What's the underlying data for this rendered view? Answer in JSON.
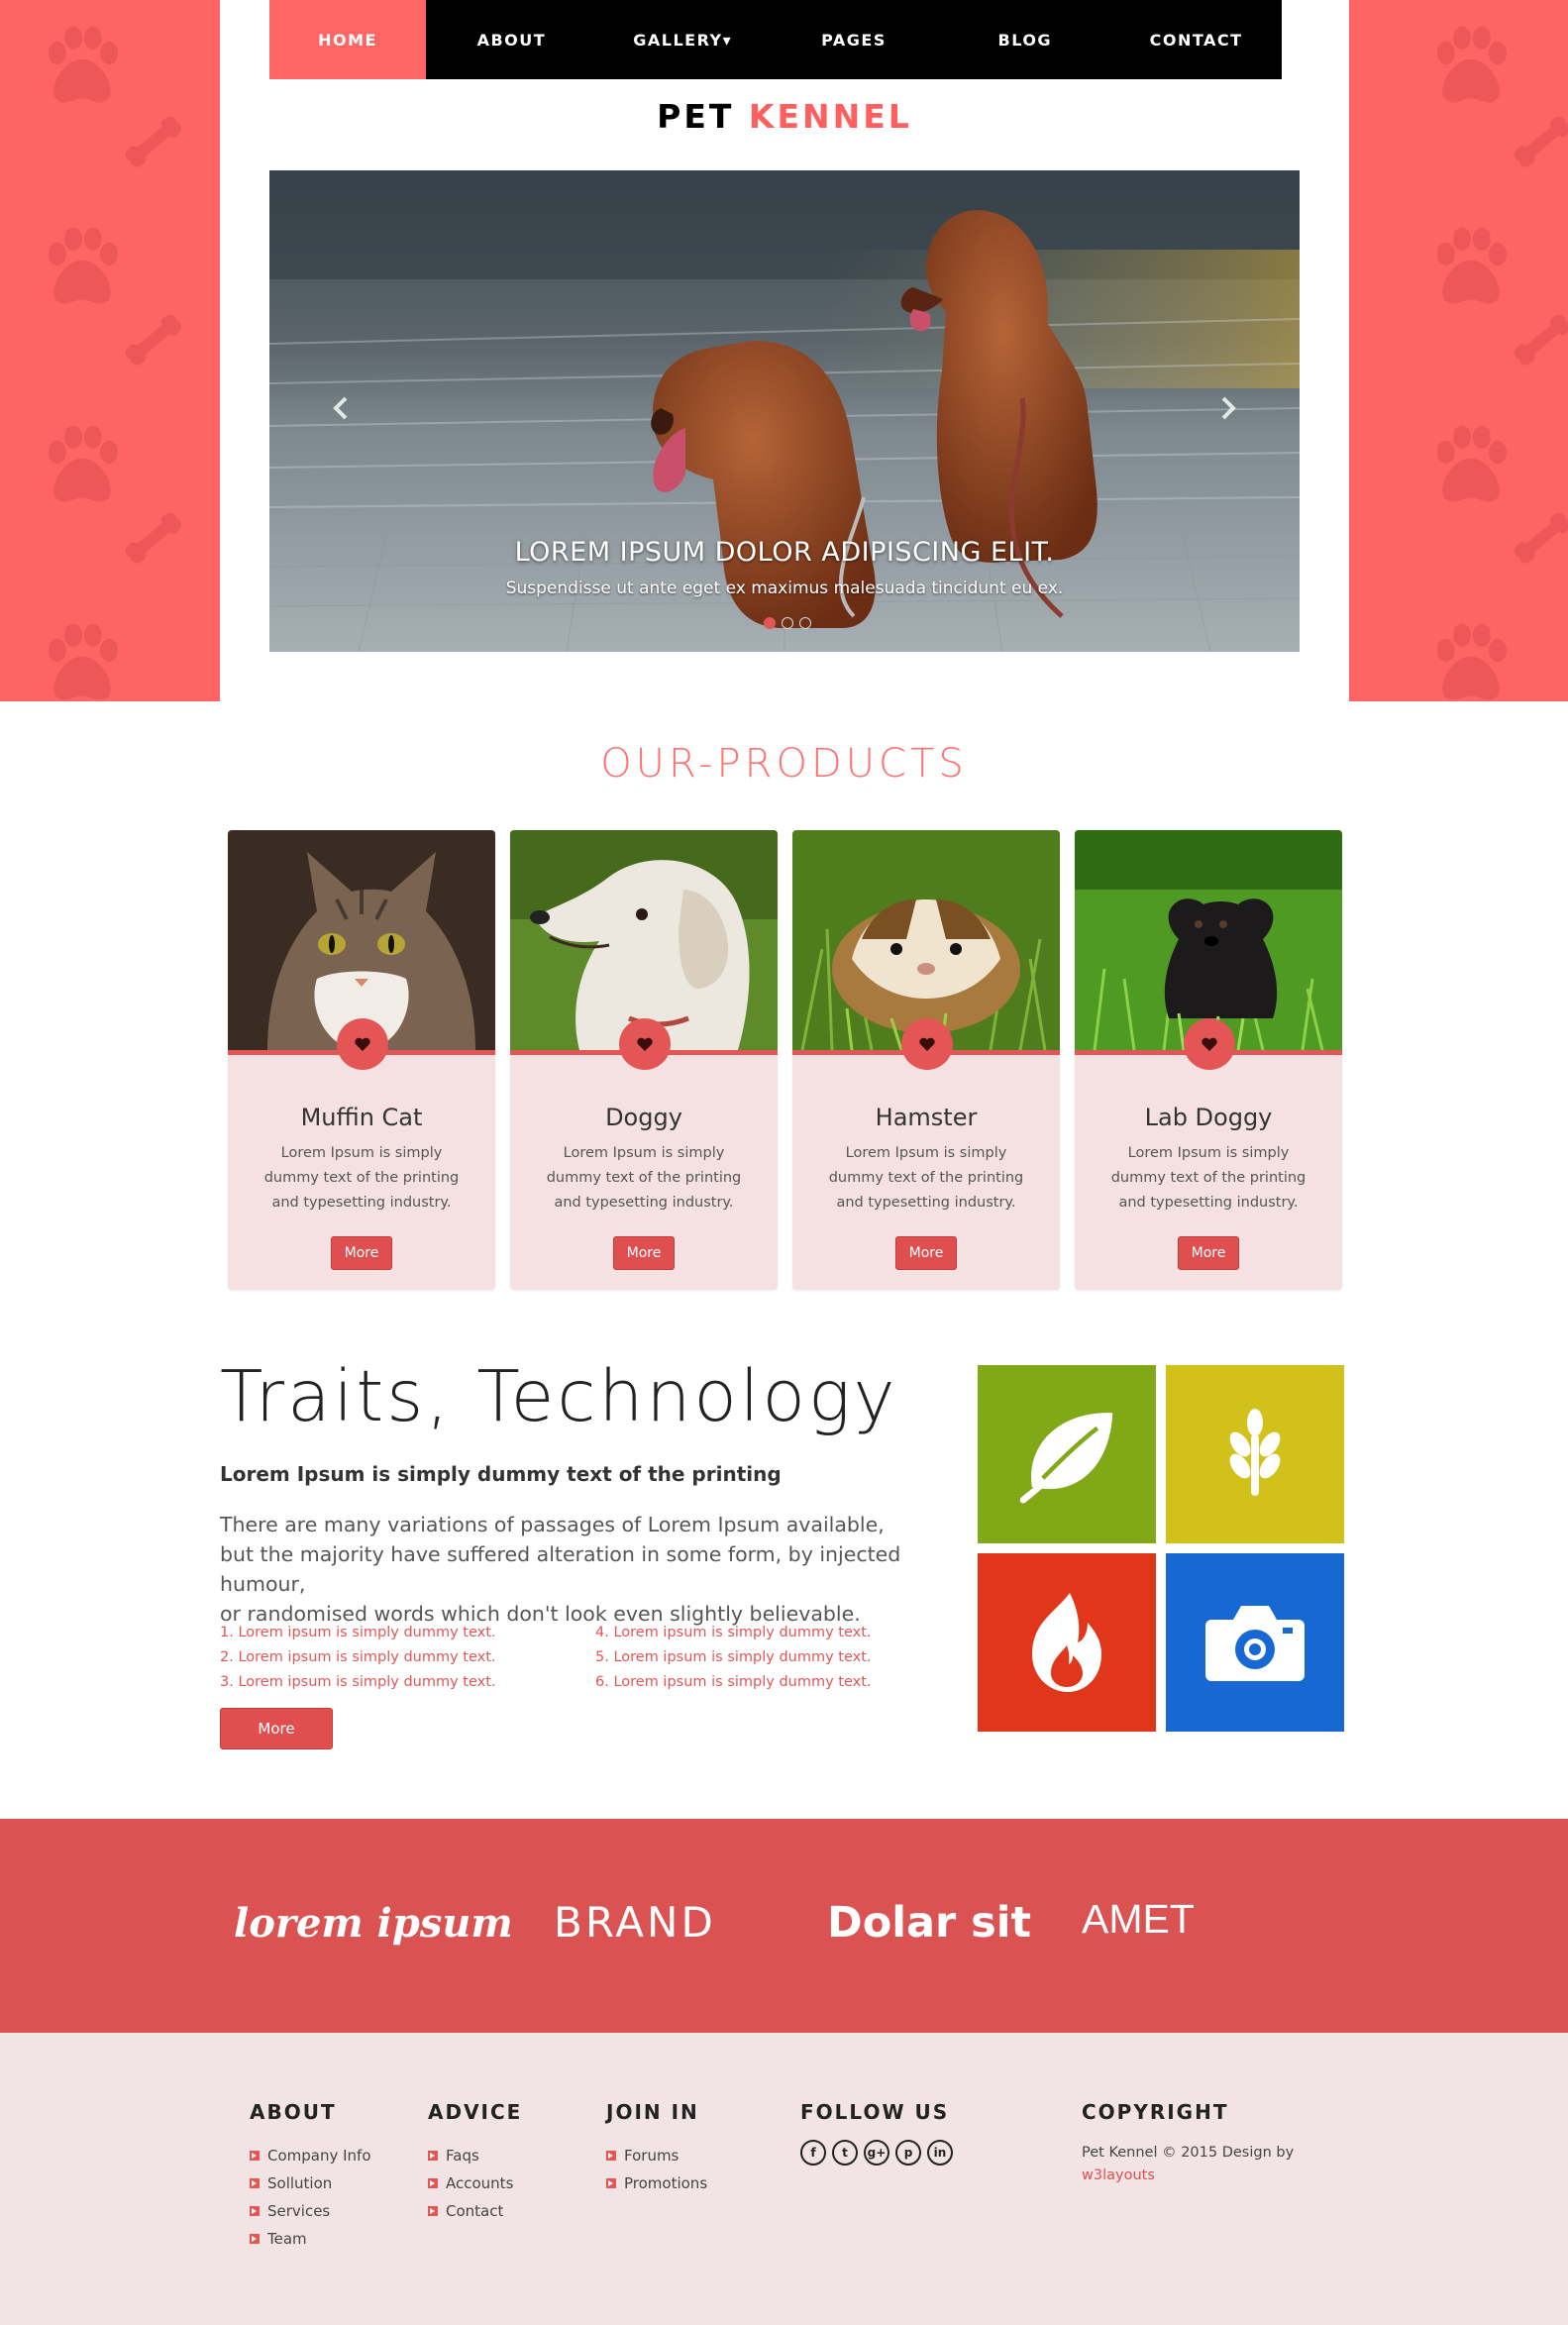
{
  "nav": {
    "items": [
      {
        "label": "HOME",
        "active": true
      },
      {
        "label": "ABOUT"
      },
      {
        "label": "GALLERY▾"
      },
      {
        "label": "PAGES"
      },
      {
        "label": "BLOG"
      },
      {
        "label": "CONTACT"
      }
    ]
  },
  "logo": {
    "part1": "PET",
    "part2": "KENNEL"
  },
  "slider": {
    "caption_title": "LOREM IPSUM DOLOR ADIPISCING ELIT.",
    "caption_text": "Suspendisse ut ante eget ex maximus malesuada tincidunt eu ex.",
    "slides": 3,
    "active_slide": 1
  },
  "products": {
    "title": "OUR-PRODUCTS",
    "items": [
      {
        "name": "Muffin Cat",
        "desc": "Lorem Ipsum is simply dummy text of the printing and typesetting industry.",
        "button": "More"
      },
      {
        "name": "Doggy",
        "desc": "Lorem Ipsum is simply dummy text of the printing and typesetting industry.",
        "button": "More"
      },
      {
        "name": "Hamster",
        "desc": "Lorem Ipsum is simply dummy text of the printing and typesetting industry.",
        "button": "More"
      },
      {
        "name": "Lab Doggy",
        "desc": "Lorem Ipsum is simply dummy text of the printing and typesetting industry.",
        "button": "More"
      }
    ]
  },
  "traits": {
    "title": "Traits, Technology",
    "subtitle": "Lorem Ipsum is simply dummy text of the printing",
    "body_lines": [
      "There are many variations of passages of Lorem Ipsum available,",
      "but the majority have suffered alteration in some form, by injected humour,",
      "or randomised words which don't look even slightly believable."
    ],
    "list_left": [
      "1. Lorem ipsum is simply dummy text.",
      "2. Lorem ipsum is simply dummy text.",
      "3. Lorem ipsum is simply dummy text."
    ],
    "list_right": [
      "4. Lorem ipsum is simply dummy text.",
      "5. Lorem ipsum is simply dummy text.",
      "6. Lorem ipsum is simply dummy text."
    ],
    "button": "More",
    "tiles": [
      {
        "icon": "leaf-icon",
        "color": "#80a817"
      },
      {
        "icon": "wheat-icon",
        "color": "#d2c11a"
      },
      {
        "icon": "flame-icon",
        "color": "#e0371a"
      },
      {
        "icon": "camera-icon",
        "color": "#1868d4"
      }
    ]
  },
  "brands": [
    "lorem ipsum",
    "BRAND",
    "Dolar sit",
    "AMET"
  ],
  "footer": {
    "about": {
      "title": "ABOUT",
      "links": [
        "Company Info",
        "Sollution",
        "Services",
        "Team"
      ]
    },
    "advice": {
      "title": "ADVICE",
      "links": [
        "Faqs",
        "Accounts",
        "Contact"
      ]
    },
    "join": {
      "title": "JOIN IN",
      "links": [
        "Forums",
        "Promotions"
      ]
    },
    "follow": {
      "title": "FOLLOW US",
      "icons": [
        "facebook-icon",
        "twitter-icon",
        "google-plus-icon",
        "pinterest-icon",
        "linkedin-icon"
      ]
    },
    "copyright": {
      "title": "COPYRIGHT",
      "text": "Pet Kennel © 2015 Design by",
      "link": "w3layouts"
    }
  },
  "colors": {
    "accent": "#ff5f5f",
    "button": "#e04f4f",
    "card_bg": "#f5e1e1",
    "footer_bg": "#f2e4e4",
    "brand_band": "#db5252"
  }
}
